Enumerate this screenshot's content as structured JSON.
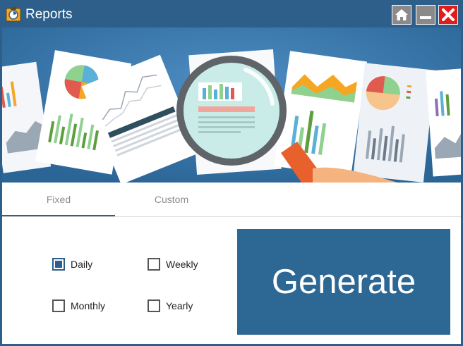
{
  "window": {
    "title": "Reports"
  },
  "titlebar": {
    "buttons": [
      {
        "name": "home",
        "icon": "home-icon"
      },
      {
        "name": "minimize",
        "icon": "minimize-icon"
      },
      {
        "name": "close",
        "icon": "close-icon"
      }
    ]
  },
  "tabs": [
    {
      "label": "Fixed",
      "active": true
    },
    {
      "label": "Custom",
      "active": false
    }
  ],
  "options": {
    "daily": {
      "label": "Daily",
      "checked": true
    },
    "weekly": {
      "label": "Weekly",
      "checked": false
    },
    "monthly": {
      "label": "Monthly",
      "checked": false
    },
    "yearly": {
      "label": "Yearly",
      "checked": false
    }
  },
  "generate": {
    "label": "Generate"
  },
  "colors": {
    "primary": "#2d5f8a",
    "button": "#2d6794",
    "close": "#e21b1b",
    "banner": "#3373a8"
  }
}
